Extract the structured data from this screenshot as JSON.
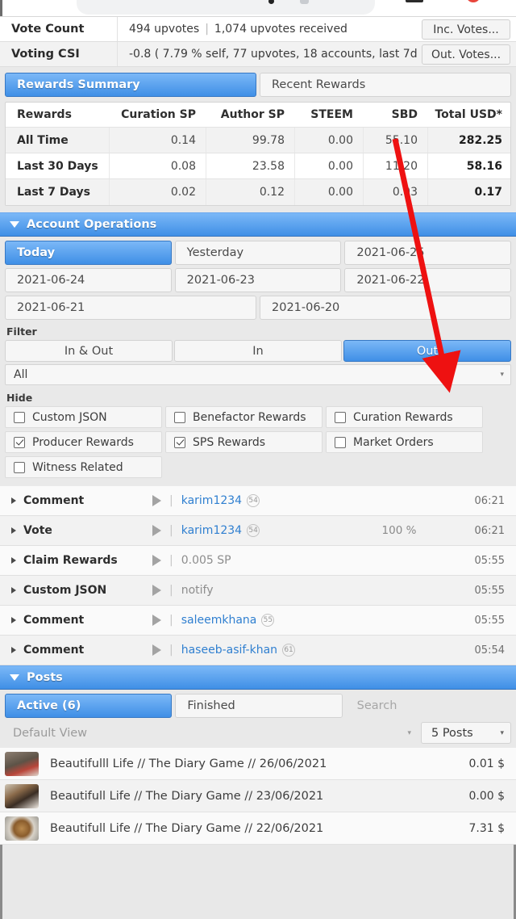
{
  "stats": {
    "rows": [
      {
        "label": "Vote Count",
        "value_main": "494 upvotes",
        "value_sep": "|",
        "value_rest": "1,074 upvotes received",
        "button": "Inc. Votes..."
      },
      {
        "label": "Voting CSI",
        "value_main": "-0.8 ( 7.79 % self, 77 upvotes, 18 accounts, last 7d )",
        "value_sep": "",
        "value_rest": "",
        "button": "Out. Votes..."
      }
    ]
  },
  "rewards": {
    "tabs": [
      {
        "label": "Rewards Summary",
        "active": true
      },
      {
        "label": "Recent Rewards",
        "active": false
      }
    ],
    "columns": [
      "Rewards",
      "Curation SP",
      "Author SP",
      "STEEM",
      "SBD",
      "Total USD*"
    ],
    "rows": [
      {
        "period": "All Time",
        "curation_sp": "0.14",
        "author_sp": "99.78",
        "steem": "0.00",
        "sbd": "55.10",
        "total_usd": "282.25"
      },
      {
        "period": "Last 30 Days",
        "curation_sp": "0.08",
        "author_sp": "23.58",
        "steem": "0.00",
        "sbd": "11.20",
        "total_usd": "58.16"
      },
      {
        "period": "Last 7 Days",
        "curation_sp": "0.02",
        "author_sp": "0.12",
        "steem": "0.00",
        "sbd": "0.03",
        "total_usd": "0.17"
      }
    ]
  },
  "account_operations": {
    "section_title": "Account Operations",
    "date_chips": [
      {
        "label": "Today",
        "active": true
      },
      {
        "label": "Yesterday",
        "active": false
      },
      {
        "label": "2021-06-25",
        "active": false
      },
      {
        "label": "2021-06-24",
        "active": false
      },
      {
        "label": "2021-06-23",
        "active": false
      },
      {
        "label": "2021-06-22",
        "active": false
      },
      {
        "label": "2021-06-21",
        "active": false
      },
      {
        "label": "2021-06-20",
        "active": false
      }
    ],
    "filter_label": "Filter",
    "direction": [
      {
        "label": "In & Out",
        "active": false
      },
      {
        "label": "In",
        "active": false
      },
      {
        "label": "Out",
        "active": true
      }
    ],
    "type_select": {
      "value": "All"
    },
    "hide_label": "Hide",
    "hide_options": [
      {
        "label": "Custom JSON",
        "checked": false
      },
      {
        "label": "Benefactor Rewards",
        "checked": false
      },
      {
        "label": "Curation Rewards",
        "checked": false
      },
      {
        "label": "Producer Rewards",
        "checked": true
      },
      {
        "label": "SPS Rewards",
        "checked": true
      },
      {
        "label": "Market Orders",
        "checked": false
      },
      {
        "label": "Witness Related",
        "checked": false
      }
    ],
    "operations": [
      {
        "type": "Comment",
        "user": "karim1234",
        "rep": "54",
        "detail": "",
        "amount": "",
        "time": "06:21"
      },
      {
        "type": "Vote",
        "user": "karim1234",
        "rep": "54",
        "detail": "",
        "amount": "100 %",
        "time": "06:21"
      },
      {
        "type": "Claim Rewards",
        "user": "",
        "rep": "",
        "detail": "0.005 SP",
        "amount": "",
        "time": "05:55"
      },
      {
        "type": "Custom JSON",
        "user": "",
        "rep": "",
        "detail": "notify",
        "amount": "",
        "time": "05:55"
      },
      {
        "type": "Comment",
        "user": "saleemkhana",
        "rep": "55",
        "detail": "",
        "amount": "",
        "time": "05:55"
      },
      {
        "type": "Comment",
        "user": "haseeb-asif-khan",
        "rep": "61",
        "detail": "",
        "amount": "",
        "time": "05:54"
      }
    ]
  },
  "posts": {
    "section_title": "Posts",
    "tabs": [
      {
        "label": "Active (6)",
        "active": true
      },
      {
        "label": "Finished",
        "active": false
      }
    ],
    "search_placeholder": "Search",
    "view_select": {
      "value": "Default View"
    },
    "count_select": {
      "value": "5 Posts"
    },
    "items": [
      {
        "title": "Beautifulll Life // The Diary Game // 26/06/2021",
        "value": "0.01 $"
      },
      {
        "title": "Beautifull Life // The Diary Game // 23/06/2021",
        "value": "0.00 $"
      },
      {
        "title": "Beautifull Life // The Diary Game // 22/06/2021",
        "value": "7.31 $"
      }
    ]
  },
  "annotation": {
    "arrow_color": "#ee1111"
  },
  "theme": {
    "accent": "#3f8fe6",
    "accent_light": "#7bb8f7",
    "link": "#2f7fd0"
  }
}
